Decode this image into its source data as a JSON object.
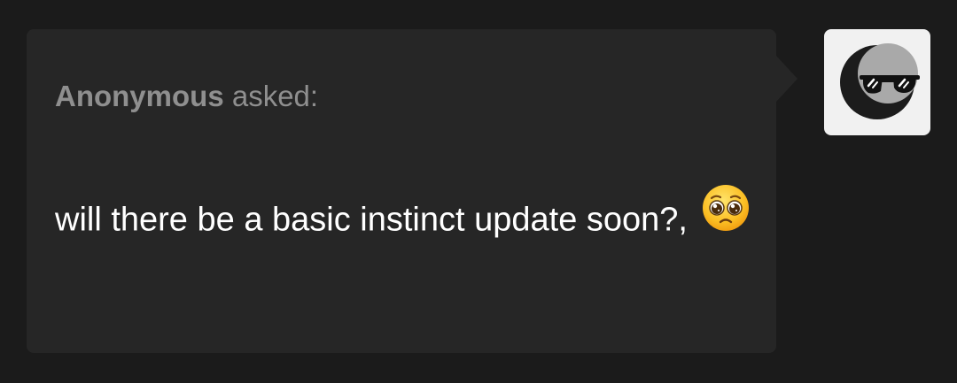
{
  "ask": {
    "asker_name": "Anonymous",
    "asked_label": " asked:",
    "question_text": "will there be a basic instinct update soon?,",
    "question_emoji": "pleading-face-emoji"
  },
  "avatar": {
    "icon": "sunglasses-moon-avatar-icon"
  },
  "colors": {
    "background": "#1b1b1b",
    "card": "#262626",
    "asker_text": "#8f8f8f",
    "question_text": "#ffffff",
    "avatar_bg": "#f1f1f1"
  }
}
